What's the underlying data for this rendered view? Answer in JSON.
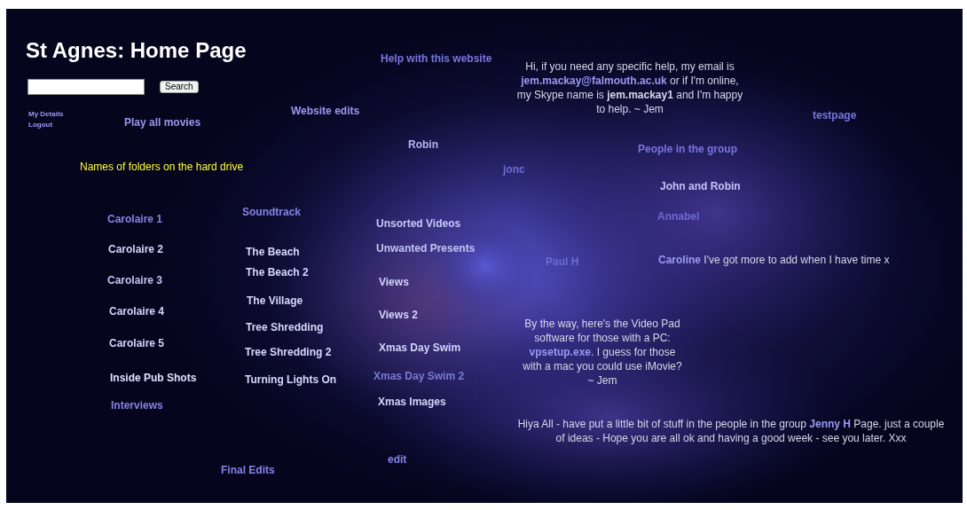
{
  "title": "St Agnes: Home Page",
  "search": {
    "button": "Search"
  },
  "account_links": [
    "My Details",
    "Logout"
  ],
  "folder_note": "Names of folders on the hard drive",
  "links": [
    {
      "label": "Help with this website",
      "color": "#7676e0"
    },
    {
      "label": "Website edits",
      "color": "#9898f0"
    },
    {
      "label": "Play all movies",
      "color": "#9898f0"
    },
    {
      "label": "Robin",
      "color": "#b4b4f4"
    },
    {
      "label": "jonc",
      "color": "#6c6cd4"
    },
    {
      "label": "testpage",
      "color": "#7676e0"
    },
    {
      "label": "People in the group",
      "color": "#7676e0"
    },
    {
      "label": "John and Robin",
      "color": "#c4c4f4"
    },
    {
      "label": "Annabel",
      "color": "#6c6cd4"
    },
    {
      "label": "Paul H",
      "color": "#6c6cd4"
    },
    {
      "label": "Carolaire 1",
      "color": "#8484e4"
    },
    {
      "label": "Carolaire 2",
      "color": "#d4d4fa"
    },
    {
      "label": "Carolaire 3",
      "color": "#c4c4f4"
    },
    {
      "label": "Carolaire 4",
      "color": "#d4d4fa"
    },
    {
      "label": "Carolaire 5",
      "color": "#d4d4fa"
    },
    {
      "label": "Inside Pub Shots",
      "color": "#e0e0ff"
    },
    {
      "label": "Interviews",
      "color": "#8484e4"
    },
    {
      "label": "Soundtrack",
      "color": "#8484e4"
    },
    {
      "label": "The Beach",
      "color": "#d8d8ff"
    },
    {
      "label": "The Beach 2",
      "color": "#d8d8ff"
    },
    {
      "label": "The Village",
      "color": "#d8d8ff"
    },
    {
      "label": "Tree Shredding",
      "color": "#d8d8ff"
    },
    {
      "label": "Tree Shredding 2",
      "color": "#d8d8ff"
    },
    {
      "label": "Turning Lights On",
      "color": "#d8d8ff"
    },
    {
      "label": "Unsorted Videos",
      "color": "#c8c8f8"
    },
    {
      "label": "Unwanted Presents",
      "color": "#c4c4f4"
    },
    {
      "label": "Views",
      "color": "#d4d4fa"
    },
    {
      "label": "Views 2",
      "color": "#d4d4fa"
    },
    {
      "label": "Xmas Day Swim",
      "color": "#d4d4fa"
    },
    {
      "label": "Xmas Day Swim 2",
      "color": "#7a7ad4"
    },
    {
      "label": "Xmas Images",
      "color": "#d4d4fa"
    },
    {
      "label": "Final Edits",
      "color": "#8484e4"
    },
    {
      "label": "edit",
      "color": "#8484e4"
    }
  ],
  "messages": [
    {
      "segments": [
        {
          "kind": "text",
          "text": "Hi, if you need any specific help, my email is "
        },
        {
          "kind": "link",
          "text": "jem.mackay@falmouth.ac.uk"
        },
        {
          "kind": "text",
          "text": " or if I'm online, my Skype name is "
        },
        {
          "kind": "bold",
          "text": "jem.mackay1"
        },
        {
          "kind": "text",
          "text": " and I'm happy to help. ~ Jem"
        }
      ]
    },
    {
      "segments": [
        {
          "kind": "link",
          "text": "Caroline"
        },
        {
          "kind": "text",
          "text": " I've got more to add when I have time x"
        }
      ]
    },
    {
      "segments": [
        {
          "kind": "text",
          "text": "By the way, here's the Video Pad software for those with a PC: "
        },
        {
          "kind": "link",
          "text": "vpsetup.exe"
        },
        {
          "kind": "text",
          "text": ". I guess for those with a mac you could use iMovie? ~ Jem"
        }
      ]
    },
    {
      "segments": [
        {
          "kind": "text",
          "text": "Hiya All - have put a little bit of stuff in the people in the group "
        },
        {
          "kind": "link",
          "text": "Jenny H"
        },
        {
          "kind": "text",
          "text": " Page. just a couple of ideas - Hope you are all ok and having a good week - see you later. Xxx"
        }
      ]
    }
  ]
}
